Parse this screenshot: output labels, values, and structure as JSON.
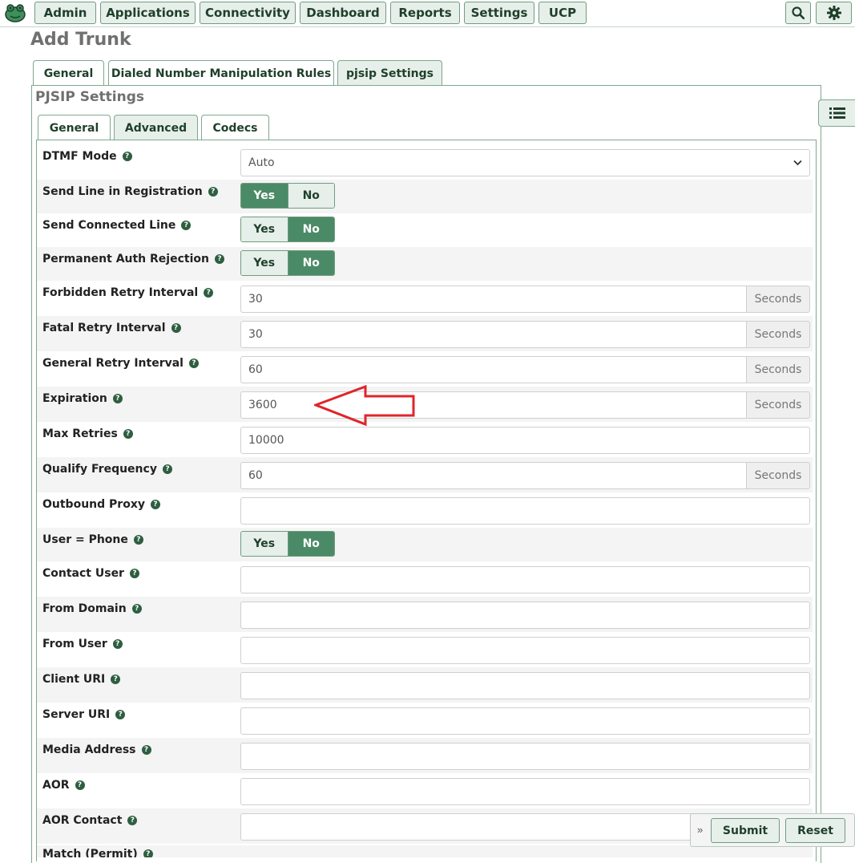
{
  "nav": {
    "items": [
      "Admin",
      "Applications",
      "Connectivity",
      "Dashboard",
      "Reports",
      "Settings",
      "UCP"
    ],
    "search_icon": "search-icon",
    "settings_icon": "gear-icon"
  },
  "page_title": "Add Trunk",
  "main_tabs": [
    "General",
    "Dialed Number Manipulation Rules",
    "pjsip Settings"
  ],
  "main_tab_active": "pjsip Settings",
  "section_title": "PJSIP Settings",
  "sub_tabs": [
    "General",
    "Advanced",
    "Codecs"
  ],
  "sub_tab_active": "Advanced",
  "help_glyph": "?",
  "toggle_labels": {
    "yes": "Yes",
    "no": "No"
  },
  "unit_seconds": "Seconds",
  "fields": {
    "dtmf_mode": {
      "label": "DTMF Mode",
      "value": "Auto"
    },
    "send_line_in_registration": {
      "label": "Send Line in Registration",
      "value": "Yes"
    },
    "send_connected_line": {
      "label": "Send Connected Line",
      "value": "No"
    },
    "permanent_auth_rejection": {
      "label": "Permanent Auth Rejection",
      "value": "No"
    },
    "forbidden_retry_interval": {
      "label": "Forbidden Retry Interval",
      "value": "30"
    },
    "fatal_retry_interval": {
      "label": "Fatal Retry Interval",
      "value": "30"
    },
    "general_retry_interval": {
      "label": "General Retry Interval",
      "value": "60"
    },
    "expiration": {
      "label": "Expiration",
      "value": "3600"
    },
    "max_retries": {
      "label": "Max Retries",
      "value": "10000"
    },
    "qualify_frequency": {
      "label": "Qualify Frequency",
      "value": "60"
    },
    "outbound_proxy": {
      "label": "Outbound Proxy",
      "value": ""
    },
    "user_phone": {
      "label": "User = Phone",
      "value": "No"
    },
    "contact_user": {
      "label": "Contact User",
      "value": ""
    },
    "from_domain": {
      "label": "From Domain",
      "value": ""
    },
    "from_user": {
      "label": "From User",
      "value": ""
    },
    "client_uri": {
      "label": "Client URI",
      "value": ""
    },
    "server_uri": {
      "label": "Server URI",
      "value": ""
    },
    "media_address": {
      "label": "Media Address",
      "value": ""
    },
    "aor": {
      "label": "AOR",
      "value": ""
    },
    "aor_contact": {
      "label": "AOR Contact",
      "value": ""
    },
    "match_permit": {
      "label": "Match (Permit)",
      "value": ""
    }
  },
  "actions": {
    "submit": "Submit",
    "reset": "Reset",
    "expand_glyph": "»"
  },
  "colors": {
    "accent_dark": "#1f3f2a",
    "accent_active": "#4b8a66",
    "button_bg": "#e6efe9",
    "annotation_arrow": "#e0242b"
  }
}
